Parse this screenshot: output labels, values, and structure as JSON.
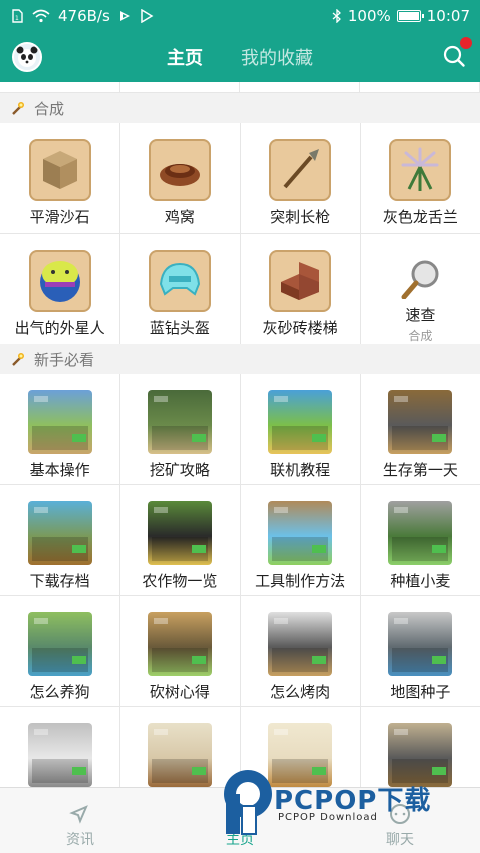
{
  "status_bar": {
    "speed": "476B/s",
    "battery": "100%",
    "time": "10:07"
  },
  "header": {
    "tabs": [
      "主页",
      "我的收藏"
    ],
    "active_tab": "主页"
  },
  "sections": [
    {
      "title": "合成",
      "items": [
        {
          "label": "平滑沙石",
          "icon": "sandstone-block-icon"
        },
        {
          "label": "鸡窝",
          "icon": "nest-icon"
        },
        {
          "label": "突刺长枪",
          "icon": "spear-icon"
        },
        {
          "label": "灰色龙舌兰",
          "icon": "agave-icon"
        },
        {
          "label": "出气的外星人",
          "icon": "alien-icon"
        },
        {
          "label": "蓝钻头盔",
          "icon": "helmet-icon"
        },
        {
          "label": "灰砂砖楼梯",
          "icon": "brick-stairs-icon"
        },
        {
          "label": "速查",
          "sub": "合成",
          "icon": "magnifier-icon"
        }
      ]
    },
    {
      "title": "新手必看",
      "items": [
        {
          "label": "基本操作"
        },
        {
          "label": "挖矿攻略"
        },
        {
          "label": "联机教程"
        },
        {
          "label": "生存第一天"
        },
        {
          "label": "下载存档"
        },
        {
          "label": "农作物一览"
        },
        {
          "label": "工具制作方法"
        },
        {
          "label": "种植小麦"
        },
        {
          "label": "怎么养狗"
        },
        {
          "label": "砍树心得"
        },
        {
          "label": "怎么烤肉"
        },
        {
          "label": "地图种子"
        },
        {
          "label": ""
        },
        {
          "label": ""
        },
        {
          "label": ""
        },
        {
          "label": ""
        }
      ]
    }
  ],
  "bottom_nav": [
    {
      "label": "资讯",
      "icon": "compass-icon"
    },
    {
      "label": "主页",
      "icon": "home-icon"
    },
    {
      "label": "聊天",
      "icon": "chat-icon"
    }
  ],
  "watermark": {
    "title": "PCPOP下载",
    "subtitle": "PCPOP Download"
  },
  "colors": {
    "accent": "#17a48c",
    "badge": "#e8242b"
  }
}
